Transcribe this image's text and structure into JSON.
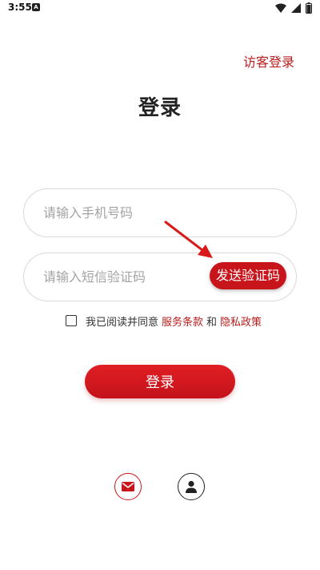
{
  "status_bar": {
    "time": "3:55",
    "notification_badge": "A"
  },
  "header": {
    "visitor_login_label": "访客登录"
  },
  "page": {
    "title": "登录"
  },
  "form": {
    "phone_placeholder": "请输入手机号码",
    "phone_value": "",
    "code_placeholder": "请输入短信验证码",
    "code_value": "",
    "send_code_label": "发送验证码"
  },
  "agreement": {
    "checked": false,
    "prefix": "我已阅读并同意",
    "terms_label": "服务条款",
    "and_label": "和",
    "privacy_label": "隐私政策"
  },
  "login_button_label": "登录",
  "alternative_logins": [
    {
      "icon": "mail-icon",
      "color": "#c8141b"
    },
    {
      "icon": "user-icon",
      "color": "#222222"
    }
  ],
  "colors": {
    "accent": "#c8141b",
    "link": "#b81c1c",
    "border": "#d9d9d9",
    "placeholder": "#a3a3a3",
    "annotation_arrow": "#d81a1a"
  }
}
